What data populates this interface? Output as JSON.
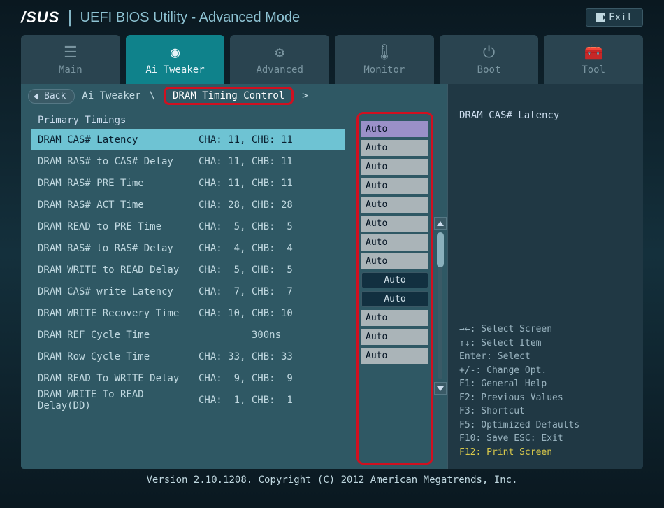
{
  "header": {
    "logo": "/SUS",
    "title": "UEFI BIOS Utility - Advanced Mode",
    "exit": "Exit"
  },
  "tabs": [
    {
      "label": "Main",
      "active": false
    },
    {
      "label": "Ai Tweaker",
      "active": true
    },
    {
      "label": "Advanced",
      "active": false
    },
    {
      "label": "Monitor",
      "active": false
    },
    {
      "label": "Boot",
      "active": false
    },
    {
      "label": "Tool",
      "active": false
    }
  ],
  "breadcrumb": {
    "back": "Back",
    "path1": "Ai Tweaker",
    "path2": "DRAM Timing Control"
  },
  "section_header": "Primary Timings",
  "settings": [
    {
      "name": "DRAM CAS# Latency",
      "info": "CHA: 11, CHB: 11",
      "value": "Auto",
      "style": "text",
      "selected": true
    },
    {
      "name": "DRAM RAS# to CAS# Delay",
      "info": "CHA: 11, CHB: 11",
      "value": "Auto",
      "style": "text"
    },
    {
      "name": "DRAM RAS# PRE Time",
      "info": "CHA: 11, CHB: 11",
      "value": "Auto",
      "style": "text"
    },
    {
      "name": "DRAM RAS# ACT Time",
      "info": "CHA: 28, CHB: 28",
      "value": "Auto",
      "style": "text"
    },
    {
      "name": "DRAM READ to PRE Time",
      "info": "CHA:  5, CHB:  5",
      "value": "Auto",
      "style": "text"
    },
    {
      "name": "DRAM RAS# to RAS# Delay",
      "info": "CHA:  4, CHB:  4",
      "value": "Auto",
      "style": "text"
    },
    {
      "name": "DRAM WRITE to READ Delay",
      "info": "CHA:  5, CHB:  5",
      "value": "Auto",
      "style": "text"
    },
    {
      "name": "DRAM CAS# write Latency",
      "info": "CHA:  7, CHB:  7",
      "value": "Auto",
      "style": "text"
    },
    {
      "name": "DRAM WRITE Recovery Time",
      "info": "CHA: 10, CHB: 10",
      "value": "Auto",
      "style": "dropdown"
    },
    {
      "name": "DRAM REF Cycle Time",
      "info": "         300ns",
      "value": "Auto",
      "style": "dropdown"
    },
    {
      "name": "DRAM Row Cycle Time",
      "info": "CHA: 33, CHB: 33",
      "value": "Auto",
      "style": "text"
    },
    {
      "name": "DRAM READ To WRITE Delay",
      "info": "CHA:  9, CHB:  9",
      "value": "Auto",
      "style": "text"
    },
    {
      "name": "DRAM WRITE To READ Delay(DD)",
      "info": "CHA:  1, CHB:  1",
      "value": "Auto",
      "style": "text"
    }
  ],
  "help": {
    "title": "DRAM CAS# Latency",
    "hints": [
      "→←: Select Screen",
      "↑↓: Select Item",
      "Enter: Select",
      "+/-: Change Opt.",
      "F1: General Help",
      "F2: Previous Values",
      "F3: Shortcut",
      "F5: Optimized Defaults",
      "F10: Save  ESC: Exit"
    ],
    "hint_highlight": "F12: Print Screen"
  },
  "footer": "Version 2.10.1208. Copyright (C) 2012 American Megatrends, Inc."
}
